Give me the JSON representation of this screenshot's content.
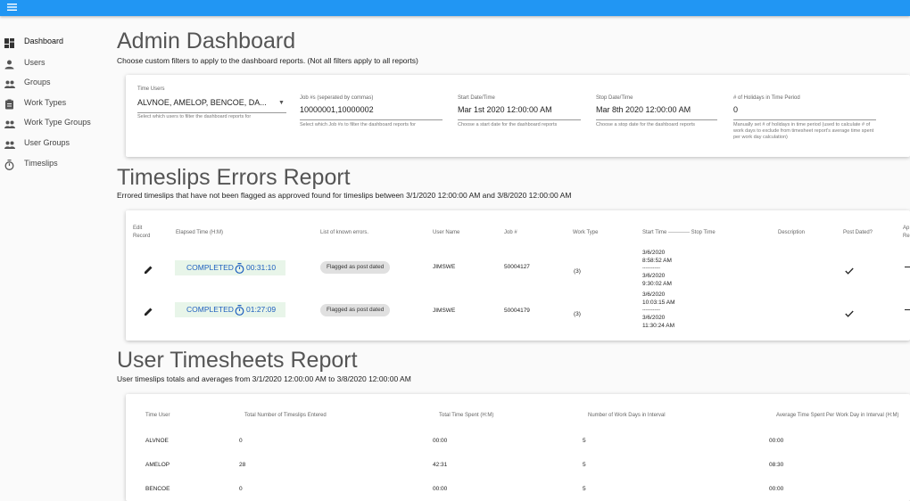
{
  "nav": {
    "items": [
      {
        "label": "Dashboard",
        "icon": "dashboard-icon"
      },
      {
        "label": "Users",
        "icon": "person-icon"
      },
      {
        "label": "Groups",
        "icon": "group-icon"
      },
      {
        "label": "Work Types",
        "icon": "clipboard-icon"
      },
      {
        "label": "Work Type Groups",
        "icon": "group-icon"
      },
      {
        "label": "User Groups",
        "icon": "group-icon"
      },
      {
        "label": "Timeslips",
        "icon": "timer-icon"
      }
    ]
  },
  "admin": {
    "title": "Admin Dashboard",
    "subtitle": "Choose custom filters to apply to the dashboard reports. (Not all filters apply to all reports)",
    "filters": {
      "users": {
        "label": "Time Users",
        "value": "ALVNOE, AMELOP, BENCOE, DA...",
        "hint": "Select which users to filter the dashboard reports for"
      },
      "jobs": {
        "label": "Job #s (seperated by commas)",
        "value": "10000001,10000002",
        "hint": "Select which Job #s to filter the dashboard reports for"
      },
      "start": {
        "label": "Start Date/Time",
        "value": "Mar 1st 2020 12:00:00 AM",
        "hint": "Choose a start date for the dashboard reports"
      },
      "stop": {
        "label": "Stop Date/Time",
        "value": "Mar 8th 2020 12:00:00 AM",
        "hint": "Choose a stop date for the dashboard reports"
      },
      "holidays": {
        "label": "# of Holidays in Time Period",
        "value": "0",
        "hint": "Manually set # of holidays in time period (used to calculate # of work days to exclude from timesheet report's average time spent per work day calculation)"
      }
    }
  },
  "errors": {
    "title": "Timeslips Errors Report",
    "subtitle": "Errored timeslips that have not been flagged as approved found for timeslips between 3/1/2020 12:00:00 AM and 3/8/2020 12:00:00 AM",
    "headers": {
      "edit_1": "Edit",
      "edit_2": "Record",
      "elapsed": "Elapsed Time (H:M)",
      "errors": "List of known errors.",
      "user": "User Name",
      "job": "Job #",
      "worktype": "Work Type",
      "startstop": "Start Time ------------ Stop Time",
      "description": "Description",
      "postdated": "Post Dated?",
      "approved_1": "Ap",
      "approved_2": "Re"
    },
    "rows": [
      {
        "status": "COMPLETED",
        "time": "00:31:10",
        "error": "Flagged as post dated",
        "user": "JIMSWE",
        "job": "50004127",
        "worktype": "(3)",
        "start_date": "3/6/2020",
        "start_time": "8:58:52 AM",
        "sep": "------------",
        "stop_date": "3/6/2020",
        "stop_time": "9:30:02 AM"
      },
      {
        "status": "COMPLETED",
        "time": "01:27:09",
        "error": "Flagged as post dated",
        "user": "JIMSWE",
        "job": "50004179",
        "worktype": "(3)",
        "start_date": "3/6/2020",
        "start_time": "10:03:15 AM",
        "sep": "------------",
        "stop_date": "3/6/2020",
        "stop_time": "11:30:24 AM"
      }
    ]
  },
  "timesheets": {
    "title": "User Timesheets Report",
    "subtitle": "User timeslips totals and averages from 3/1/2020 12:00:00 AM to 3/8/2020 12:00:00 AM",
    "headers": {
      "user": "Time User",
      "total": "Total Number of Timeslips Entered",
      "spent": "Total Time Spent (H:M)",
      "days": "Number of Work Days in Interval",
      "avg": "Average Time Spent Per Work Day in Interval (H:M)"
    },
    "rows": [
      {
        "user": "ALVNOE",
        "total": "0",
        "spent": "00:00",
        "days": "5",
        "avg": "00:00"
      },
      {
        "user": "AMELOP",
        "total": "28",
        "spent": "42:31",
        "days": "5",
        "avg": "08:30"
      },
      {
        "user": "BENCOE",
        "total": "0",
        "spent": "00:00",
        "days": "5",
        "avg": "00:00"
      }
    ]
  }
}
